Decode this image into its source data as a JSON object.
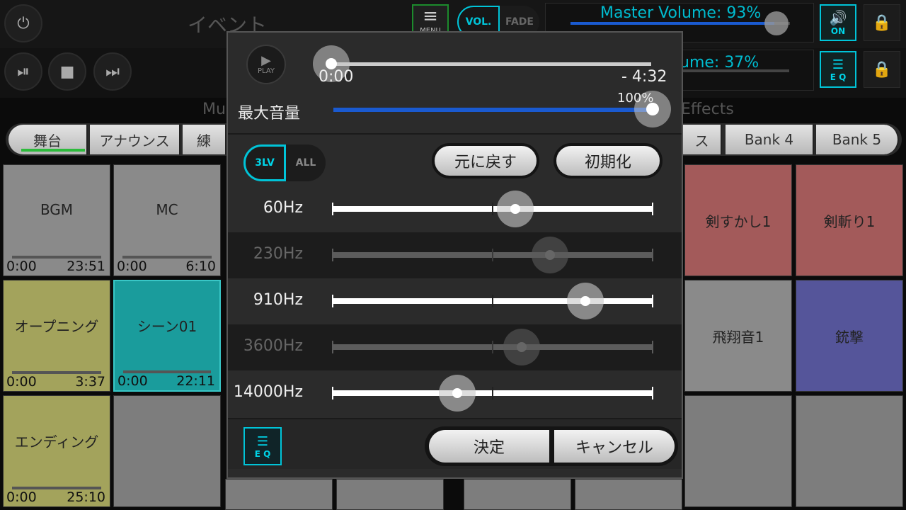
{
  "header": {
    "title": "イベント",
    "menu_label": "MENU",
    "vol_label": "VOL.",
    "fade_label": "FADE",
    "master_volume": "Master Volume: 93%",
    "master_volume_value": 0.93,
    "second_volume": "ume: 37%",
    "second_volume_value": 0.37,
    "speaker_on_label": "ON",
    "eq_label": "E Q"
  },
  "sections": {
    "left": "Mu",
    "right": "Effects"
  },
  "banks": [
    "舞台",
    "アナウンス",
    "練",
    "ス",
    "Bank 4",
    "Bank 5"
  ],
  "pads": [
    {
      "name": "BGM",
      "t1": "0:00",
      "t2": "23:51"
    },
    {
      "name": "MC",
      "t1": "0:00",
      "t2": "6:10"
    },
    {
      "name": "オープニング",
      "t1": "0:00",
      "t2": "3:37"
    },
    {
      "name": "シーン01",
      "t1": "0:00",
      "t2": "22:11"
    },
    {
      "name": "エンディング",
      "t1": "0:00",
      "t2": "25:10"
    },
    {
      "name": "剣すかし1",
      "t1": "",
      "t2": ""
    },
    {
      "name": "剣斬り1",
      "t1": "",
      "t2": ""
    },
    {
      "name": "飛翔音1",
      "t1": "",
      "t2": ""
    },
    {
      "name": "銃撃",
      "t1": "",
      "t2": ""
    }
  ],
  "dialog": {
    "play_label": "PLAY",
    "position": "0:00",
    "remaining": "- 4:32",
    "max_volume_label": "最大音量",
    "max_volume_pct": "100%",
    "max_volume_value": 1.0,
    "mode_3lv": "3LV",
    "mode_all": "ALL",
    "revert_label": "元に戻す",
    "reset_label": "初期化",
    "eq_bands": [
      {
        "label": "60Hz",
        "value": 0.57,
        "enabled": true
      },
      {
        "label": "230Hz",
        "value": 0.68,
        "enabled": false
      },
      {
        "label": "910Hz",
        "value": 0.79,
        "enabled": true
      },
      {
        "label": "3600Hz",
        "value": 0.59,
        "enabled": false
      },
      {
        "label": "14000Hz",
        "value": 0.39,
        "enabled": true
      }
    ],
    "eq_badge": "E Q",
    "ok_label": "決定",
    "cancel_label": "キャンセル"
  },
  "colors": {
    "accent_cyan": "#00c4d8",
    "volume_blue": "#1a5ad0",
    "pad_yellow": "#a3a35c",
    "pad_teal": "#1a9c9c",
    "pad_red": "#a35a5a",
    "pad_purple": "#55559a",
    "pad_gray": "#8a8a8a"
  }
}
